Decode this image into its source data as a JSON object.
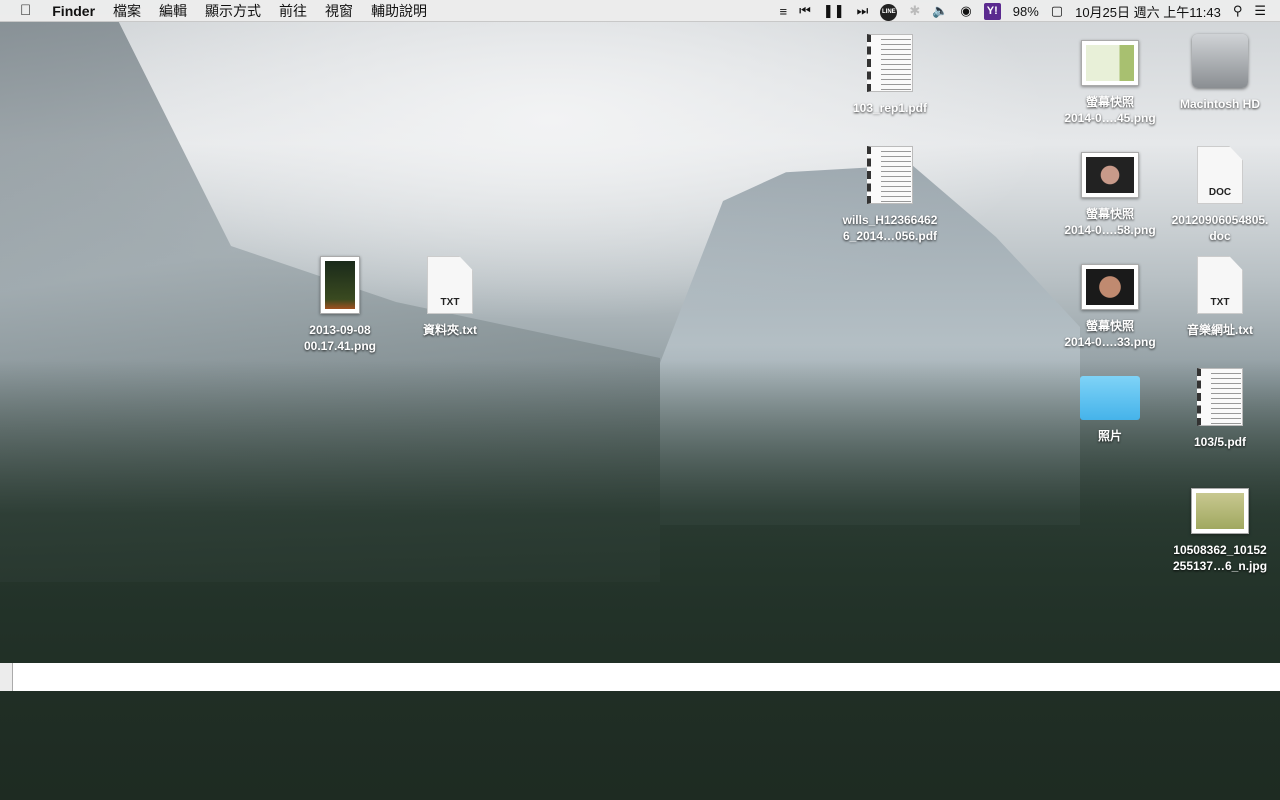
{
  "menubar": {
    "app": "Finder",
    "menus": [
      "檔案",
      "編輯",
      "顯示方式",
      "前往",
      "視窗",
      "輔助說明"
    ],
    "status": {
      "battery": "98%",
      "datetime": "10月25日 週六 上午11:43",
      "yahoo": "Y!",
      "line": "LINE"
    }
  },
  "desktop": {
    "icons": [
      {
        "label": "103_rep1.pdf",
        "kind": "pdf"
      },
      {
        "label": "wills_H12366462 6_2014…056.pdf",
        "kind": "pdf"
      },
      {
        "label": "螢幕快照 2014-0….45.png",
        "kind": "png"
      },
      {
        "label": "Macintosh HD",
        "kind": "hd"
      },
      {
        "label": "螢幕快照 2014-0….58.png",
        "kind": "png"
      },
      {
        "label": "20120906054805. doc",
        "kind": "doc",
        "badge": "DOC"
      },
      {
        "label": "2013-09-08 00.17.41.png",
        "kind": "png"
      },
      {
        "label": "資料夾.txt",
        "kind": "txt",
        "badge": "TXT"
      },
      {
        "label": "螢幕快照 2014-0….33.png",
        "kind": "png"
      },
      {
        "label": "音樂網址.txt",
        "kind": "txt",
        "badge": "TXT"
      },
      {
        "label": "照片",
        "kind": "folder"
      },
      {
        "label": "103/5.pdf",
        "kind": "pdf"
      },
      {
        "label": "10508362_10152 255137…6_n.jpg",
        "kind": "png"
      }
    ]
  },
  "input": {
    "value": ""
  }
}
